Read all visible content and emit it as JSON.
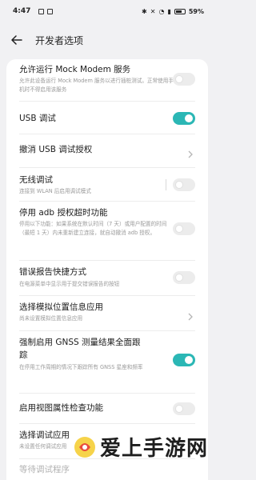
{
  "status": {
    "time": "4:47",
    "battery": "59%"
  },
  "header": {
    "title": "开发者选项"
  },
  "rows": [
    {
      "title": "允许运行 Mock Modem 服务",
      "subtitle": "允许此设备运行 Mock Modem 服务以进行插桩测试。正常使用手机时不得启用该服务",
      "control": "toggle",
      "state": "off"
    },
    {
      "title": "USB 调试",
      "subtitle": "",
      "control": "toggle",
      "state": "on"
    },
    {
      "title": "撤消 USB 调试授权",
      "subtitle": "",
      "control": "chevron"
    },
    {
      "title": "无线调试",
      "subtitle": "连接到 WLAN 后启用调试模式",
      "control": "toggle",
      "state": "off"
    },
    {
      "title": "停用 adb 授权超时功能",
      "subtitle": "停用以下功能：如果系统在默认时间（7 天）或用户配置的时间（最短 1 天）内未重新建立连接，就自动撤消 adb 授权。",
      "control": "toggle",
      "state": "off"
    },
    {
      "title": "错误报告快捷方式",
      "subtitle": "在电源菜单中显示用于提交错误报告的按钮",
      "control": "toggle",
      "state": "off"
    },
    {
      "title": "选择模拟位置信息应用",
      "subtitle": "尚未设置模拟位置信息应用",
      "control": "chevron"
    },
    {
      "title": "强制启用 GNSS 测量结果全面跟",
      "title2": "踪",
      "subtitle": "在停用工作周期的情况下跟踪所有 GNSS 星座和频率",
      "control": "toggle",
      "state": "on"
    },
    {
      "title": "启用视图属性检查功能",
      "subtitle": "",
      "control": "toggle",
      "state": "off"
    },
    {
      "title": "选择调试应用",
      "subtitle": "未设置任何调试应用",
      "control": "chevron"
    },
    {
      "title": "等待调试程序",
      "subtitle": ""
    }
  ],
  "watermark": {
    "text": "爱上手游网"
  }
}
